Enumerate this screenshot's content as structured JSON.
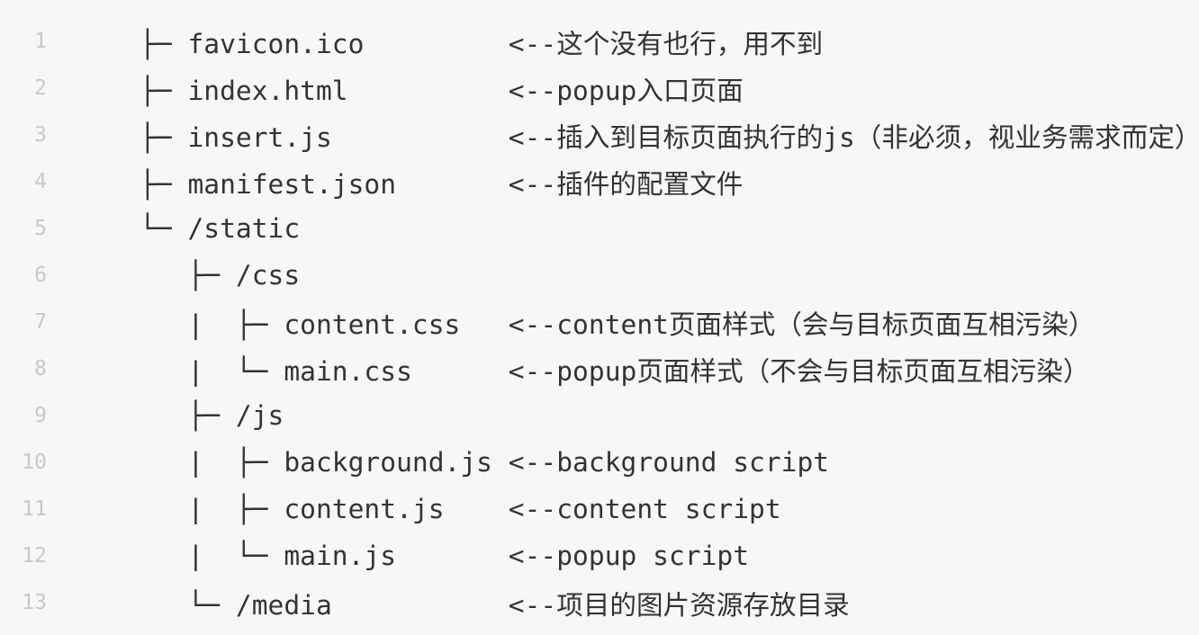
{
  "colors": {
    "background": "#f7f7f7",
    "text": "#333333",
    "line_number": "#c8c8c8"
  },
  "lines": [
    {
      "n": "1",
      "text": "├─ favicon.ico         <--这个没有也行，用不到"
    },
    {
      "n": "2",
      "text": "├─ index.html          <--popup入口页面"
    },
    {
      "n": "3",
      "text": "├─ insert.js           <--插入到目标页面执行的js（非必须，视业务需求而定）"
    },
    {
      "n": "4",
      "text": "├─ manifest.json       <--插件的配置文件"
    },
    {
      "n": "5",
      "text": "└─ /static"
    },
    {
      "n": "6",
      "text": "   ├─ /css"
    },
    {
      "n": "7",
      "text": "   |  ├─ content.css   <--content页面样式（会与目标页面互相污染）"
    },
    {
      "n": "8",
      "text": "   |  └─ main.css      <--popup页面样式（不会与目标页面互相污染）"
    },
    {
      "n": "9",
      "text": "   ├─ /js"
    },
    {
      "n": "10",
      "text": "   |  ├─ background.js <--background script"
    },
    {
      "n": "11",
      "text": "   |  ├─ content.js    <--content script"
    },
    {
      "n": "12",
      "text": "   |  └─ main.js       <--popup script"
    },
    {
      "n": "13",
      "text": "   └─ /media           <--项目的图片资源存放目录"
    }
  ]
}
